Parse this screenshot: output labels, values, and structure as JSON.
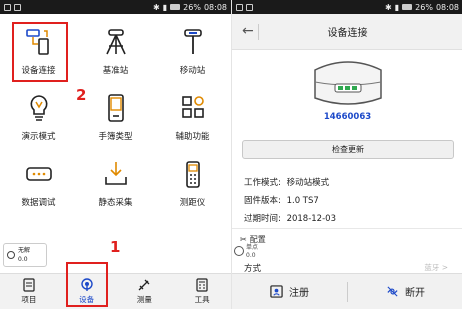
{
  "status_left": {
    "time": "08:08",
    "battery": "26%"
  },
  "status_right": {
    "time": "08:08",
    "battery": "26%"
  },
  "left_grid": [
    {
      "label": "设备连接",
      "icon": "device-connect-icon"
    },
    {
      "label": "基准站",
      "icon": "base-station-icon"
    },
    {
      "label": "移动站",
      "icon": "rover-station-icon"
    },
    {
      "label": "演示模式",
      "icon": "lightbulb-icon"
    },
    {
      "label": "手簿类型",
      "icon": "handheld-icon"
    },
    {
      "label": "辅助功能",
      "icon": "grid-apps-icon"
    },
    {
      "label": "数据调试",
      "icon": "debug-icon"
    },
    {
      "label": "静态采集",
      "icon": "download-tray-icon"
    },
    {
      "label": "测距仪",
      "icon": "rangefinder-icon"
    }
  ],
  "annotations": {
    "one": "1",
    "two": "2"
  },
  "mini_widget": {
    "line1": "无解",
    "line2": "0.0"
  },
  "tabs": [
    {
      "label": "项目",
      "icon": "project-icon",
      "active": false
    },
    {
      "label": "设备",
      "icon": "device-tab-icon",
      "active": true
    },
    {
      "label": "测量",
      "icon": "measure-icon",
      "active": false
    },
    {
      "label": "工具",
      "icon": "tools-icon",
      "active": false
    }
  ],
  "right": {
    "title": "设备连接",
    "serial": "14660063",
    "check_update": "检查更新",
    "work_mode_key": "工作模式:",
    "work_mode_val": "移动站模式",
    "firmware_key": "固件版本:",
    "firmware_val": "1.0  TS7",
    "expiry_key": "过期时间:",
    "expiry_val": "2018-12-03",
    "config_label": "配置",
    "float_line1": "单点",
    "float_line2": "0.0",
    "mode_label": "方式",
    "mode_value": "蓝牙 >",
    "register": "注册",
    "disconnect": "断开"
  },
  "colors": {
    "accent": "#1c49c9",
    "annotation": "#e0201e"
  }
}
